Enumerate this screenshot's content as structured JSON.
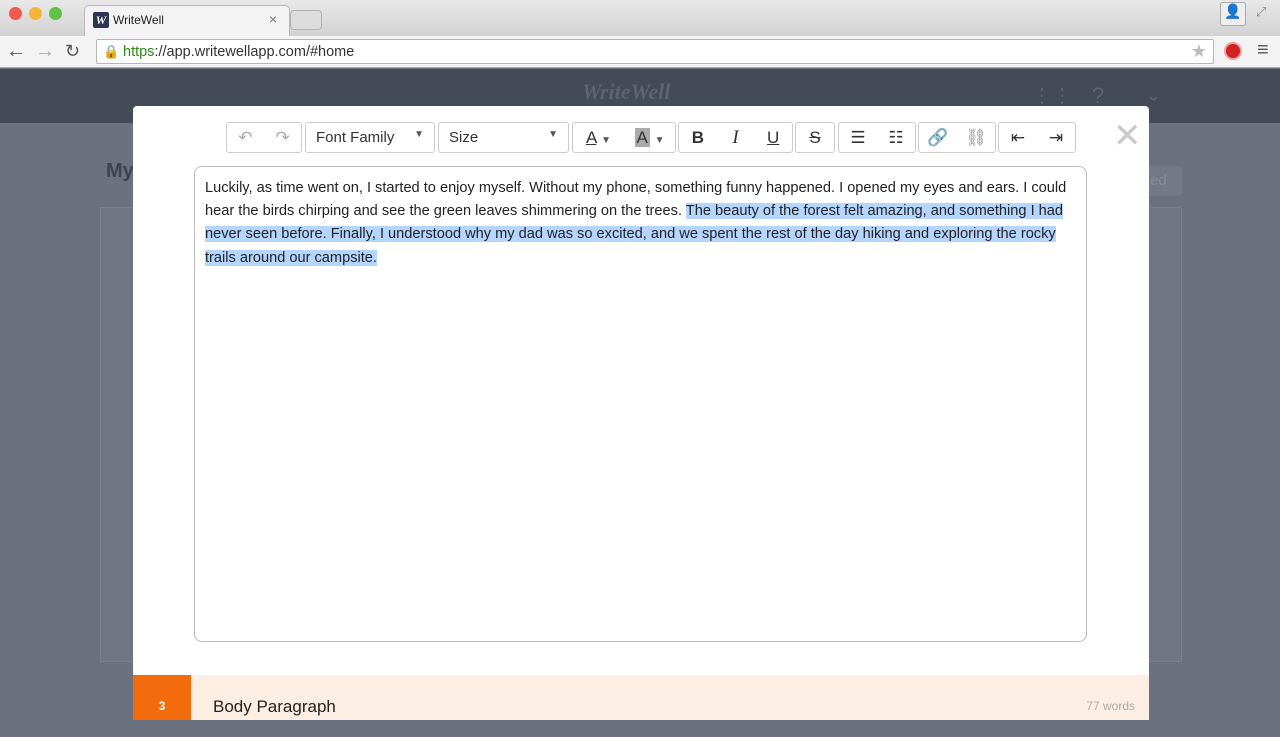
{
  "browser": {
    "tab_title": "WriteWell",
    "tab_close": "×",
    "url_scheme": "https",
    "url_rest": "://app.writewellapp.com/#home"
  },
  "app": {
    "logo": "WriteWell",
    "bg_title": "My",
    "bg_button": "ed"
  },
  "toolbar": {
    "font_family": "Font Family",
    "size": "Size",
    "bold": "B",
    "italic": "I",
    "underline": "U",
    "strike": "S",
    "font_color": "A",
    "highlight": "A"
  },
  "editor": {
    "text_plain": "Luckily, as time went on, I started to enjoy myself. Without my phone, something funny happened. I opened my eyes and ears. I could hear the birds chirping and see the green leaves shimmering on the trees. ",
    "text_selected": "The beauty of the forest felt amazing, and something I had never seen before. Finally, I understood why my dad was so excited, and we spent the rest of the day hiking and exploring the rocky trails around our campsite."
  },
  "footer": {
    "number": "3",
    "title": "Body Paragraph",
    "word_count": "77 words"
  },
  "colors": {
    "accent": "#f26c0d",
    "selection": "#b4d5fe",
    "footer_bg": "#fdeee3"
  }
}
